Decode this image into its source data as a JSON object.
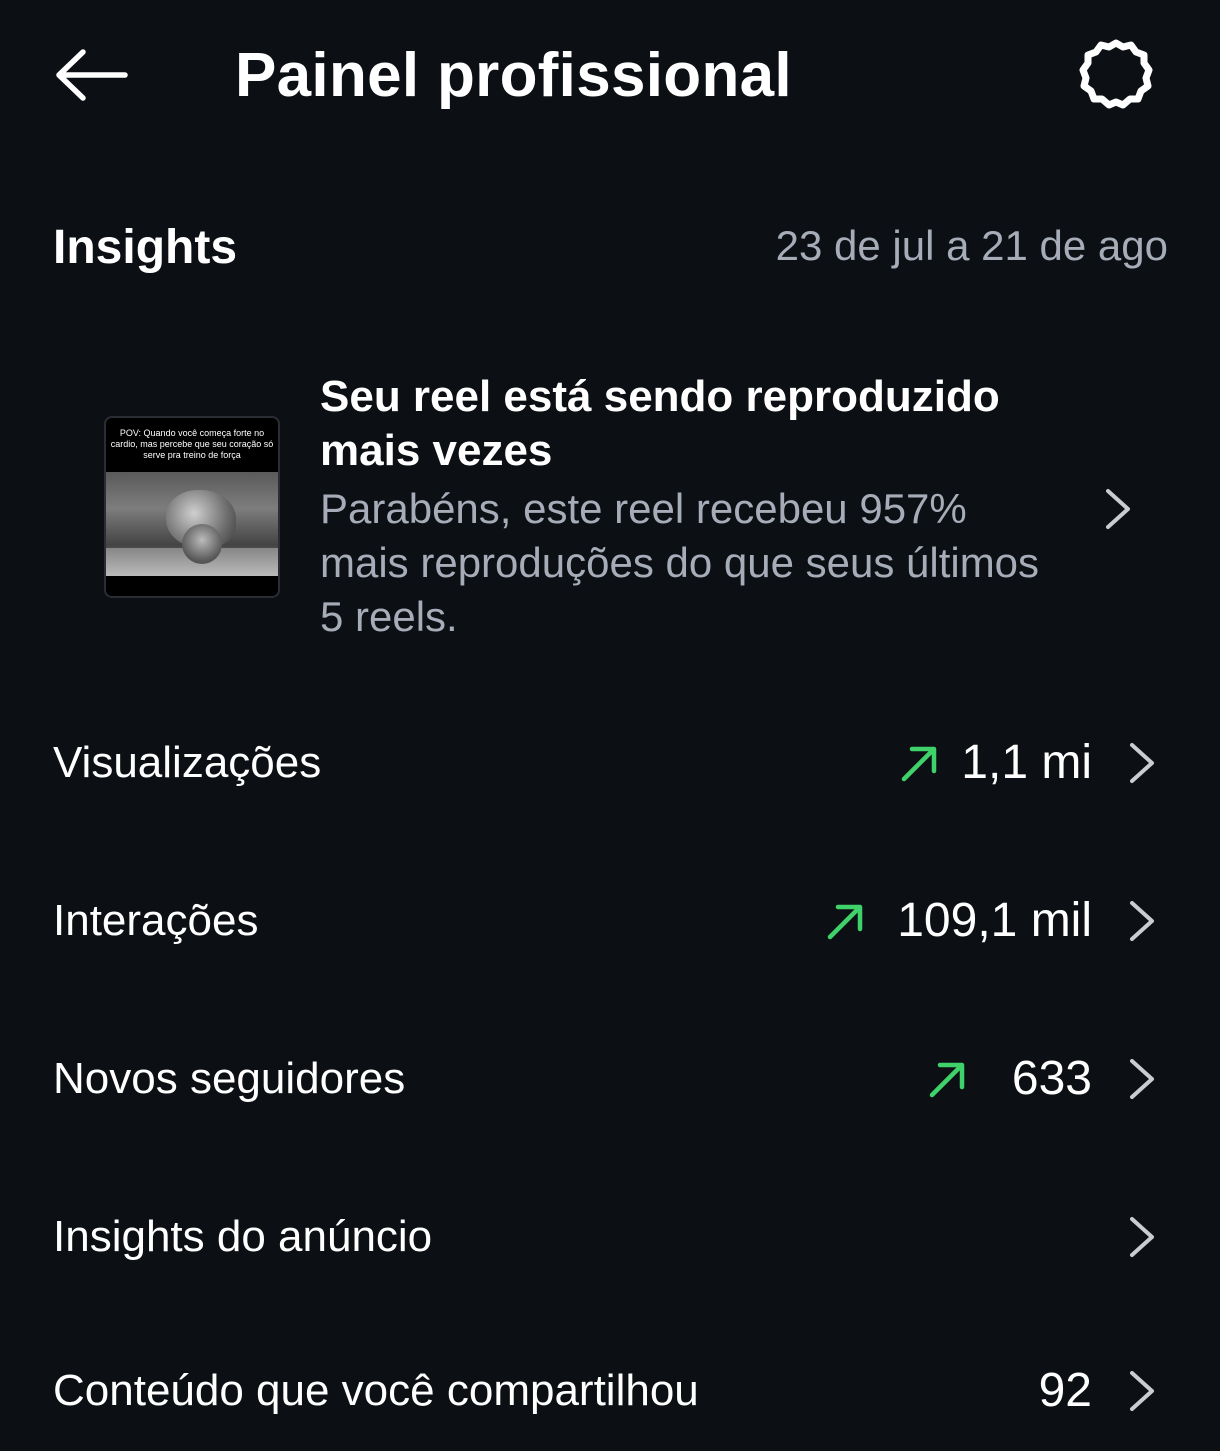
{
  "header": {
    "title": "Painel profissional",
    "back_icon": "arrow-left-icon",
    "settings_icon": "gear-icon"
  },
  "insights": {
    "title": "Insights",
    "date_range": "23 de jul a 21 de ago"
  },
  "reel_card": {
    "title": "Seu reel está sendo reproduzido mais vezes",
    "description": "Parabéns, este reel recebeu 957% mais reproduções do que seus últimos 5 reels.",
    "thumbnail_caption": "POV: Quando você começa forte no cardio, mas percebe que seu coração só serve pra treino de força",
    "chevron_icon": "chevron-right-icon"
  },
  "metrics": [
    {
      "label": "Visualizações",
      "value": "1,1 mi",
      "trend": "up"
    },
    {
      "label": "Interações",
      "value": "109,1 mil",
      "trend": "up"
    },
    {
      "label": "Novos seguidores",
      "value": "633",
      "trend": "up"
    },
    {
      "label": "Insights do anúncio",
      "value": "",
      "trend": "none"
    },
    {
      "label": "Conteúdo que você compartilhou",
      "value": "92",
      "trend": "none"
    }
  ],
  "colors": {
    "background": "#0c0f14",
    "primary_text": "#ffffff",
    "secondary_text": "#a6adb8",
    "trend_up": "#3fd26a",
    "chevron": "#c9ccd1"
  }
}
